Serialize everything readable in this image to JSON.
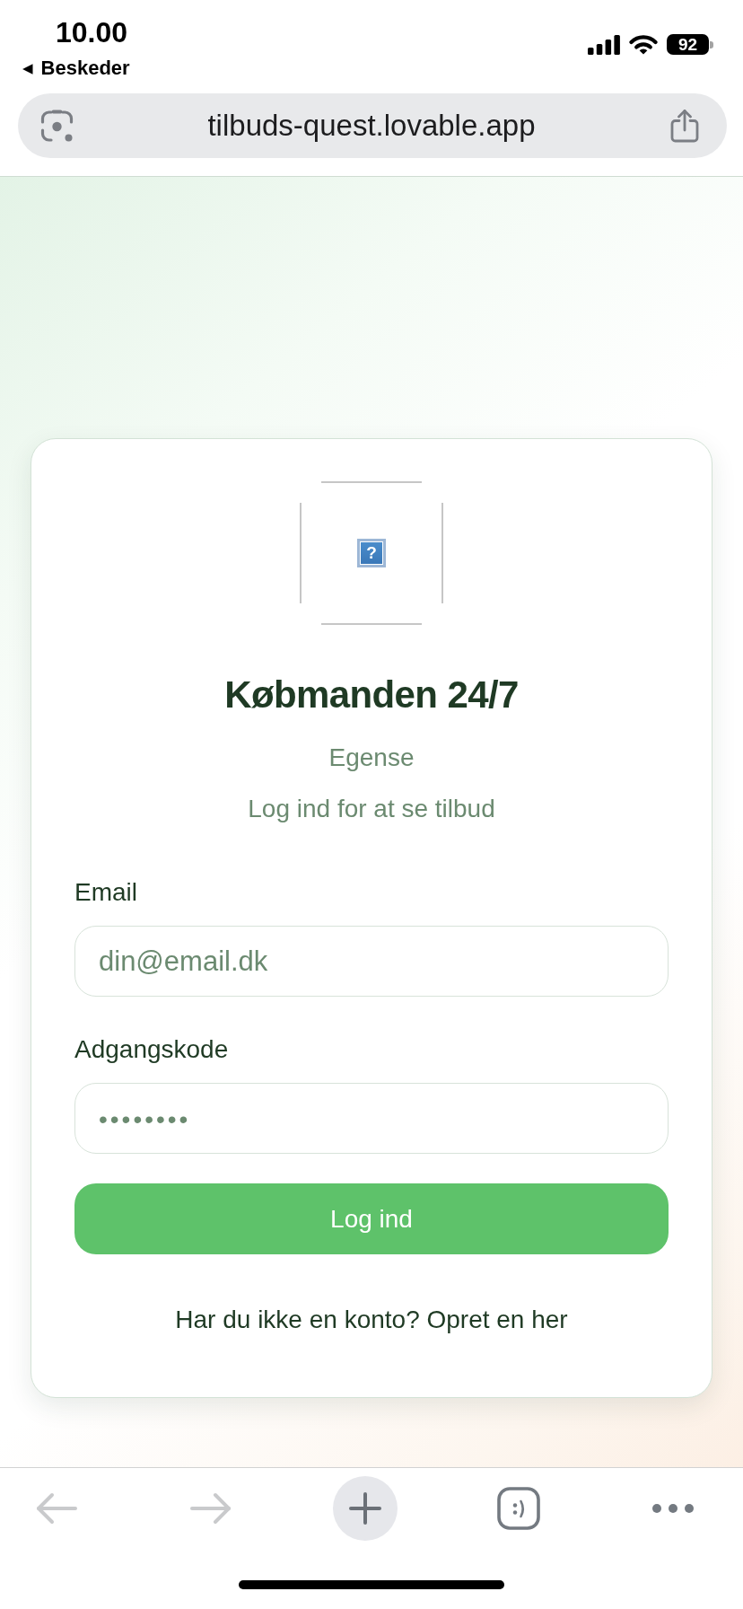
{
  "status_bar": {
    "time": "10.00",
    "back_glyph": "◀",
    "back_label": "Beskeder",
    "battery": "92"
  },
  "address_bar": {
    "url": "tilbuds-quest.lovable.app"
  },
  "login_card": {
    "logo": {
      "kind": "broken_image",
      "glyph": "?"
    },
    "title": "Købmanden 24/7",
    "subtitle": "Egense",
    "tagline": "Log ind for at se tilbud",
    "fields": [
      {
        "kind": "email",
        "label": "Email",
        "placeholder": "din@email.dk"
      },
      {
        "kind": "password",
        "label": "Adgangskode",
        "placeholder": "••••••••"
      }
    ],
    "submit_button": "Log ind",
    "signup_link": "Har du ikke en konto? Opret en her"
  },
  "toolbar": {
    "items": [
      {
        "kind": "back",
        "disabled": true
      },
      {
        "kind": "forward",
        "disabled": true
      },
      {
        "kind": "new_tab",
        "disabled": false
      },
      {
        "kind": "tabs",
        "disabled": false
      },
      {
        "kind": "more",
        "disabled": false
      }
    ]
  }
}
